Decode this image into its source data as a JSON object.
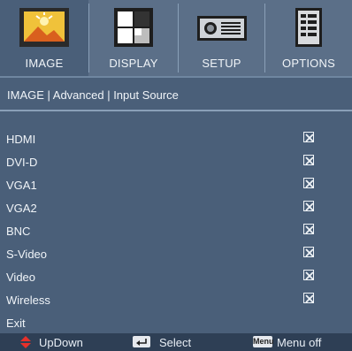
{
  "tabs": [
    {
      "label": "IMAGE",
      "icon": "image-icon",
      "active": true
    },
    {
      "label": "DISPLAY",
      "icon": "display-icon",
      "active": false
    },
    {
      "label": "SETUP",
      "icon": "projector-icon",
      "active": false
    },
    {
      "label": "OPTIONS",
      "icon": "options-icon",
      "active": false
    }
  ],
  "breadcrumb": "IMAGE | Advanced | Input Source",
  "items": [
    {
      "label": "HDMI",
      "checked": true
    },
    {
      "label": "DVI-D",
      "checked": true
    },
    {
      "label": "VGA1",
      "checked": true
    },
    {
      "label": "VGA2",
      "checked": true
    },
    {
      "label": "BNC",
      "checked": true
    },
    {
      "label": "S-Video",
      "checked": true
    },
    {
      "label": "Video",
      "checked": true
    },
    {
      "label": "Wireless",
      "checked": true
    }
  ],
  "exit_label": "Exit",
  "footer": {
    "updown_label": "UpDown",
    "select_label": "Select",
    "menu_key": "Menu",
    "menuoff_label": "Menu off"
  },
  "colors": {
    "background": "#5b6f88",
    "panel": "#4a5f79",
    "footer": "#2e3f55",
    "accent_red": "#e8302a"
  }
}
